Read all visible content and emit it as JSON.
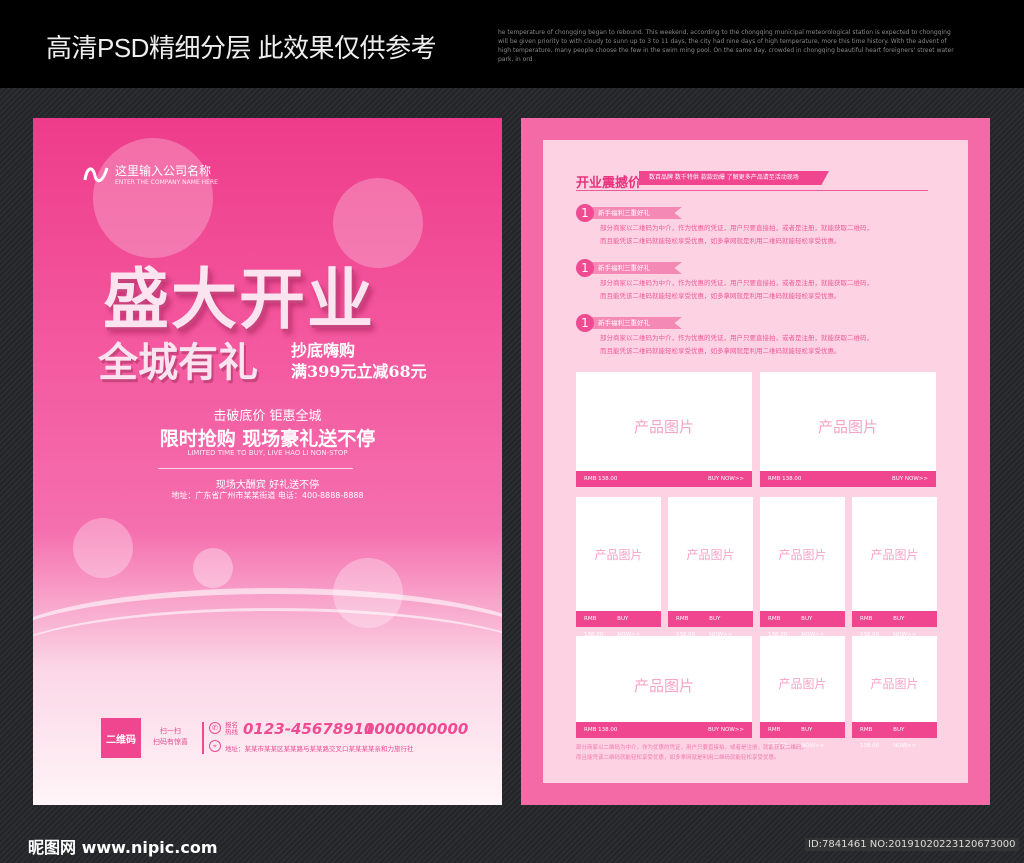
{
  "header": {
    "title": "高清PSD精细分层 此效果仅供参考",
    "paragraph": "he temperature of chongqing began to rebound. This weekend, according to the chongqing municipal meteorological station is expected to chongqing will be given priority to with cloudy to sunn up to 3 to 11 days, the city had nine days of high temperature, more this time history. With the advent of high temperature, many people choose the few in the swim ming pool. On the same day, crowded in chongqing beautiful heart foreigners' street water park, in ord"
  },
  "front": {
    "company_name": "这里输入公司名称",
    "company_en": "ENTER THE COMPANY NAME HERE",
    "title": "盛大开业",
    "subtitle": "全城有礼",
    "promo1": "抄底嗨购",
    "promo2": "满399元立减68元",
    "slogan1": "击破底价 钜惠全城",
    "slogan2": "限时抢购 现场豪礼送不停",
    "slogan_en": "LIMITED TIME TO BUY, LIVE HAO LI NON-STOP",
    "event": "现场大酬宾 好礼送不停",
    "address_line": "地址：广东省广州市某某街道 电话：400-8888-8888",
    "qr_label": "二维码",
    "scan1": "扫一扫",
    "scan2": "扫码有惊喜",
    "hotline_label": "报名热线",
    "phone1": "0123-45678910",
    "phone2": "1000000000",
    "address": "地址：某某市某某区某某路与某某路交叉口某某某某亲和力旅行社"
  },
  "back": {
    "heading": "开业震撼价",
    "ribbon": "数百品牌 数千特供 款款劲爆  了解更多产品请至活动现场",
    "items": [
      {
        "num": "1",
        "tag": "新手福利三重好礼",
        "desc1": "部分商家以二维码为中介，作为优惠的凭证，用户只要直接拍，或者是注册，就能获取二维码，",
        "desc2": "而且能凭该二维码就能轻松享受优惠，如多拿网就是利用二维码就能轻松享受优惠。"
      },
      {
        "num": "1",
        "tag": "新手福利三重好礼",
        "desc1": "部分商家以二维码为中介，作为优惠的凭证，用户只要直接拍，或者是注册，就能获取二维码，",
        "desc2": "而且能凭该二维码就能轻松享受优惠，如多拿网就是利用二维码就能轻松享受优惠。"
      },
      {
        "num": "1",
        "tag": "新手福利三重好礼",
        "desc1": "部分商家以二维码为中介，作为优惠的凭证，用户只要直接拍，或者是注册，就能获取二维码，",
        "desc2": "而且能凭该二维码就能轻松享受优惠，如多拿网就是利用二维码就能轻松享受优惠。"
      }
    ],
    "product_label": "产品图片",
    "price": "RMB 138.00",
    "buy": "BUY NOW>>",
    "note1": "部分商家以二维码为中介，作为优惠的凭证，用户只要直接拍，或者是注册，就能获取二维码，",
    "note2": "而且能凭该二维码就能轻松享受优惠，如多拿网就是利用二维码就能轻松享受优惠。"
  },
  "footer": {
    "site": "昵图网 www.nipic.com",
    "id": "ID:7841461 NO:20191020223120673000"
  },
  "colors": {
    "accent": "#f0468f",
    "panel": "#fdd3e4"
  }
}
